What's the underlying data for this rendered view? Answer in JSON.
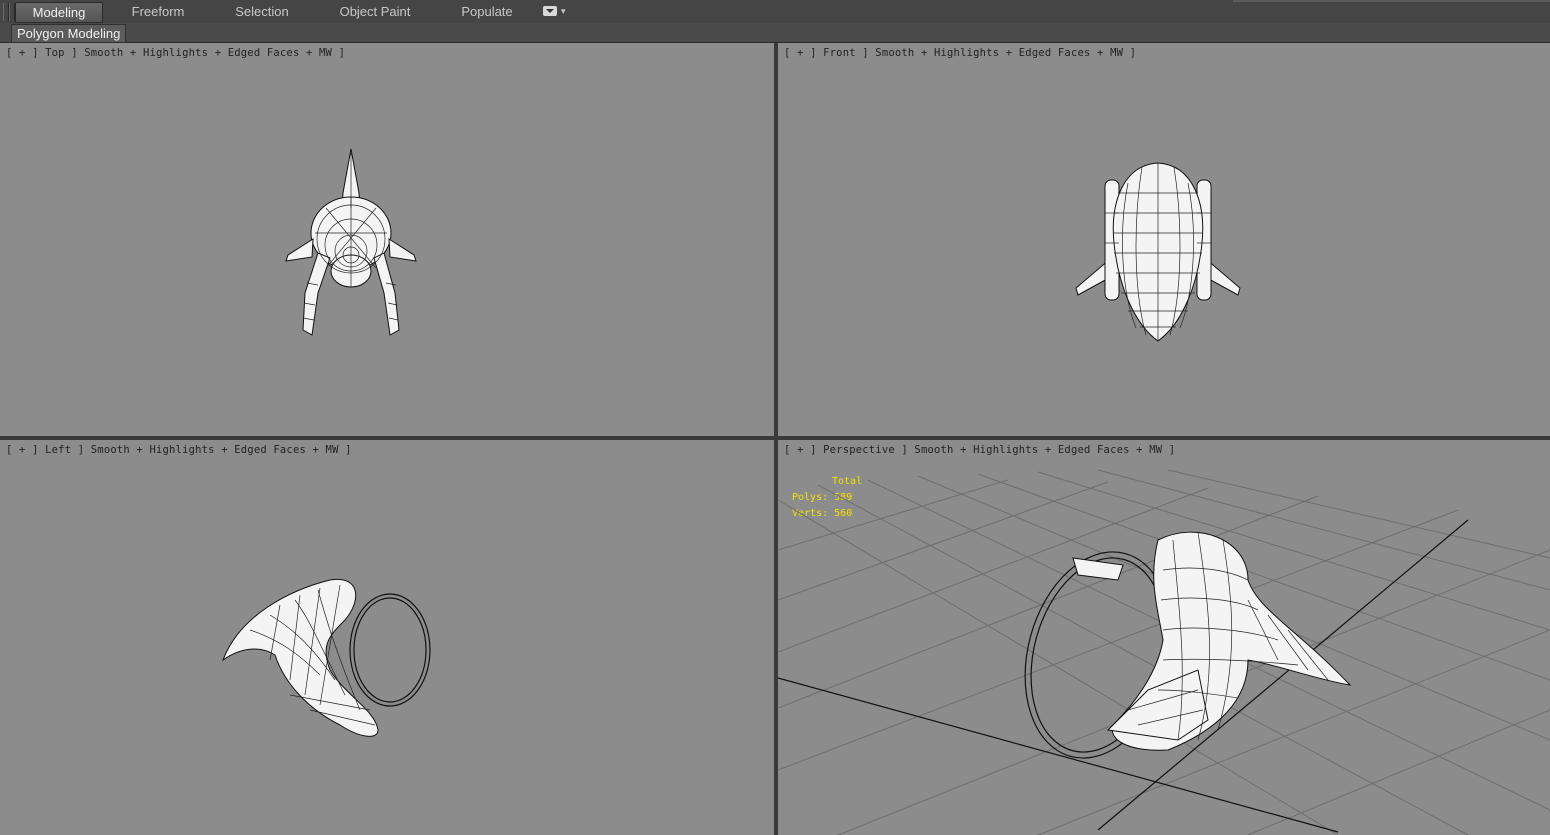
{
  "ribbon": {
    "tabs": [
      {
        "label": "Modeling",
        "active": true
      },
      {
        "label": "Freeform"
      },
      {
        "label": "Selection"
      },
      {
        "label": "Object Paint"
      },
      {
        "label": "Populate"
      }
    ],
    "panel_label": "Polygon Modeling"
  },
  "viewports": {
    "top": {
      "label": "[ + ] Top ] Smooth + Highlights + Edged Faces + MW ]"
    },
    "front": {
      "label": "[ + ] Front ] Smooth + Highlights + Edged Faces + MW ]"
    },
    "left": {
      "label": "[ + ] Left ] Smooth + Highlights + Edged Faces + MW ]"
    },
    "perspective": {
      "label": "[ + ] Perspective ] Smooth + Highlights + Edged Faces + MW ]"
    }
  },
  "stats": {
    "title": "Total",
    "polys_label": "Polys:",
    "polys_value": "589",
    "verts_label": "Verts:",
    "verts_value": "560"
  },
  "colors": {
    "viewport_bg": "#8c8c8c",
    "stats_text": "#f2e200",
    "ui_dark": "#454545"
  }
}
